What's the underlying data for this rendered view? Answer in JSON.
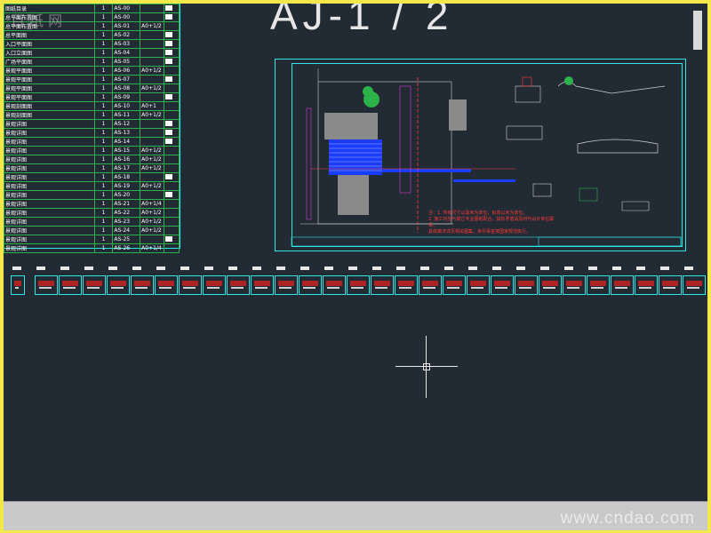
{
  "watermark_top": "百 纸 网",
  "watermark_bottom": "www.cndao.com",
  "sheet_label": "AJ-1 / 2",
  "index_rows": [
    {
      "name": "图纸目录",
      "cnt": "1",
      "code": "AS-00",
      "size": ""
    },
    {
      "name": "总平面布置图",
      "cnt": "1",
      "code": "AS-00",
      "size": ""
    },
    {
      "name": "总平面布置图",
      "cnt": "1",
      "code": "AS-01",
      "size": "A0+1/2"
    },
    {
      "name": "总平面图",
      "cnt": "1",
      "code": "AS-02",
      "size": ""
    },
    {
      "name": "入口平面图",
      "cnt": "1",
      "code": "AS-03",
      "size": ""
    },
    {
      "name": "入口立面图",
      "cnt": "1",
      "code": "AS-04",
      "size": ""
    },
    {
      "name": "广场平面图",
      "cnt": "1",
      "code": "AS-05",
      "size": ""
    },
    {
      "name": "景观平面图",
      "cnt": "1",
      "code": "AS-06",
      "size": "A0+1/2"
    },
    {
      "name": "景观平面图",
      "cnt": "1",
      "code": "AS-07",
      "size": ""
    },
    {
      "name": "景观平面图",
      "cnt": "1",
      "code": "AS-08",
      "size": "A0+1/2"
    },
    {
      "name": "景观平面图",
      "cnt": "1",
      "code": "AS-09",
      "size": ""
    },
    {
      "name": "景观剖面图",
      "cnt": "1",
      "code": "AS-10",
      "size": "A0+1"
    },
    {
      "name": "景观剖面图",
      "cnt": "1",
      "code": "AS-11",
      "size": "A0+1/2"
    },
    {
      "name": "景观详图",
      "cnt": "1",
      "code": "AS-12",
      "size": ""
    },
    {
      "name": "景观详图",
      "cnt": "1",
      "code": "AS-13",
      "size": ""
    },
    {
      "name": "景观详图",
      "cnt": "1",
      "code": "AS-14",
      "size": ""
    },
    {
      "name": "景观详图",
      "cnt": "1",
      "code": "AS-15",
      "size": "A0+1/2"
    },
    {
      "name": "景观详图",
      "cnt": "1",
      "code": "AS-16",
      "size": "A0+1/2"
    },
    {
      "name": "景观详图",
      "cnt": "1",
      "code": "AS-17",
      "size": "A0+1/2"
    },
    {
      "name": "景观详图",
      "cnt": "1",
      "code": "AS-18",
      "size": ""
    },
    {
      "name": "景观详图",
      "cnt": "1",
      "code": "AS-19",
      "size": "A0+1/2"
    },
    {
      "name": "景观详图",
      "cnt": "1",
      "code": "AS-20",
      "size": ""
    },
    {
      "name": "景观详图",
      "cnt": "1",
      "code": "AS-21",
      "size": "A0+1/4"
    },
    {
      "name": "景观详图",
      "cnt": "1",
      "code": "AS-22",
      "size": "A0+1/2"
    },
    {
      "name": "景观详图",
      "cnt": "1",
      "code": "AS-23",
      "size": "A0+1/2"
    },
    {
      "name": "景观详图",
      "cnt": "1",
      "code": "AS-24",
      "size": "A0+1/2"
    },
    {
      "name": "景观详图",
      "cnt": "1",
      "code": "AS-25",
      "size": ""
    },
    {
      "name": "景观详图",
      "cnt": "1",
      "code": "AS-26",
      "size": "A0+1/4"
    }
  ],
  "notes": [
    "注：1. 所有尺寸以毫米为单位，标高以米为单位。",
    "2. 施工时应与其它专业图纸配合，如有矛盾请及时与设计单位联系。",
    "具体做法详见相关图集，未尽事宜按国家规范执行。"
  ],
  "thumbnails_count": 29,
  "colors": {
    "canvas": "#222a33",
    "frame": "#f2e84a",
    "cyan": "#2ee6e6",
    "green": "#2db24a",
    "red": "#ff3a3a",
    "blue": "#1a3cff"
  }
}
